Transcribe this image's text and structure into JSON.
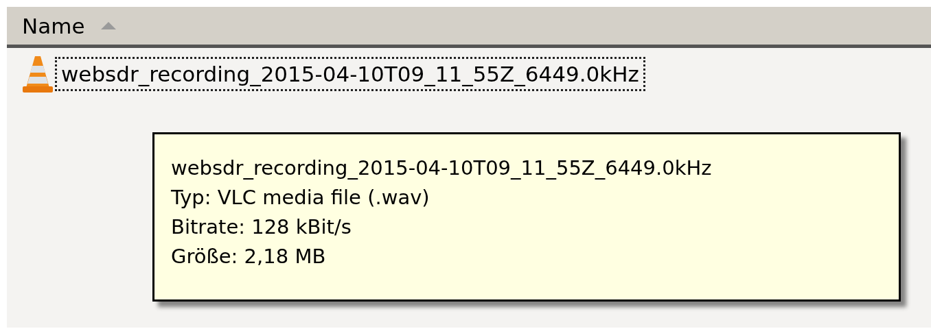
{
  "columns": [
    {
      "label": "Name",
      "sorted": true
    }
  ],
  "files": [
    {
      "name": "websdr_recording_2015-04-10T09_11_55Z_6449.0kHz",
      "focused": true
    }
  ],
  "tooltip": {
    "lines": [
      "websdr_recording_2015-04-10T09_11_55Z_6449.0kHz",
      "Typ: VLC media file (.wav)",
      "Bitrate: 128 kBit/s",
      "Größe: 2,18 MB"
    ]
  }
}
